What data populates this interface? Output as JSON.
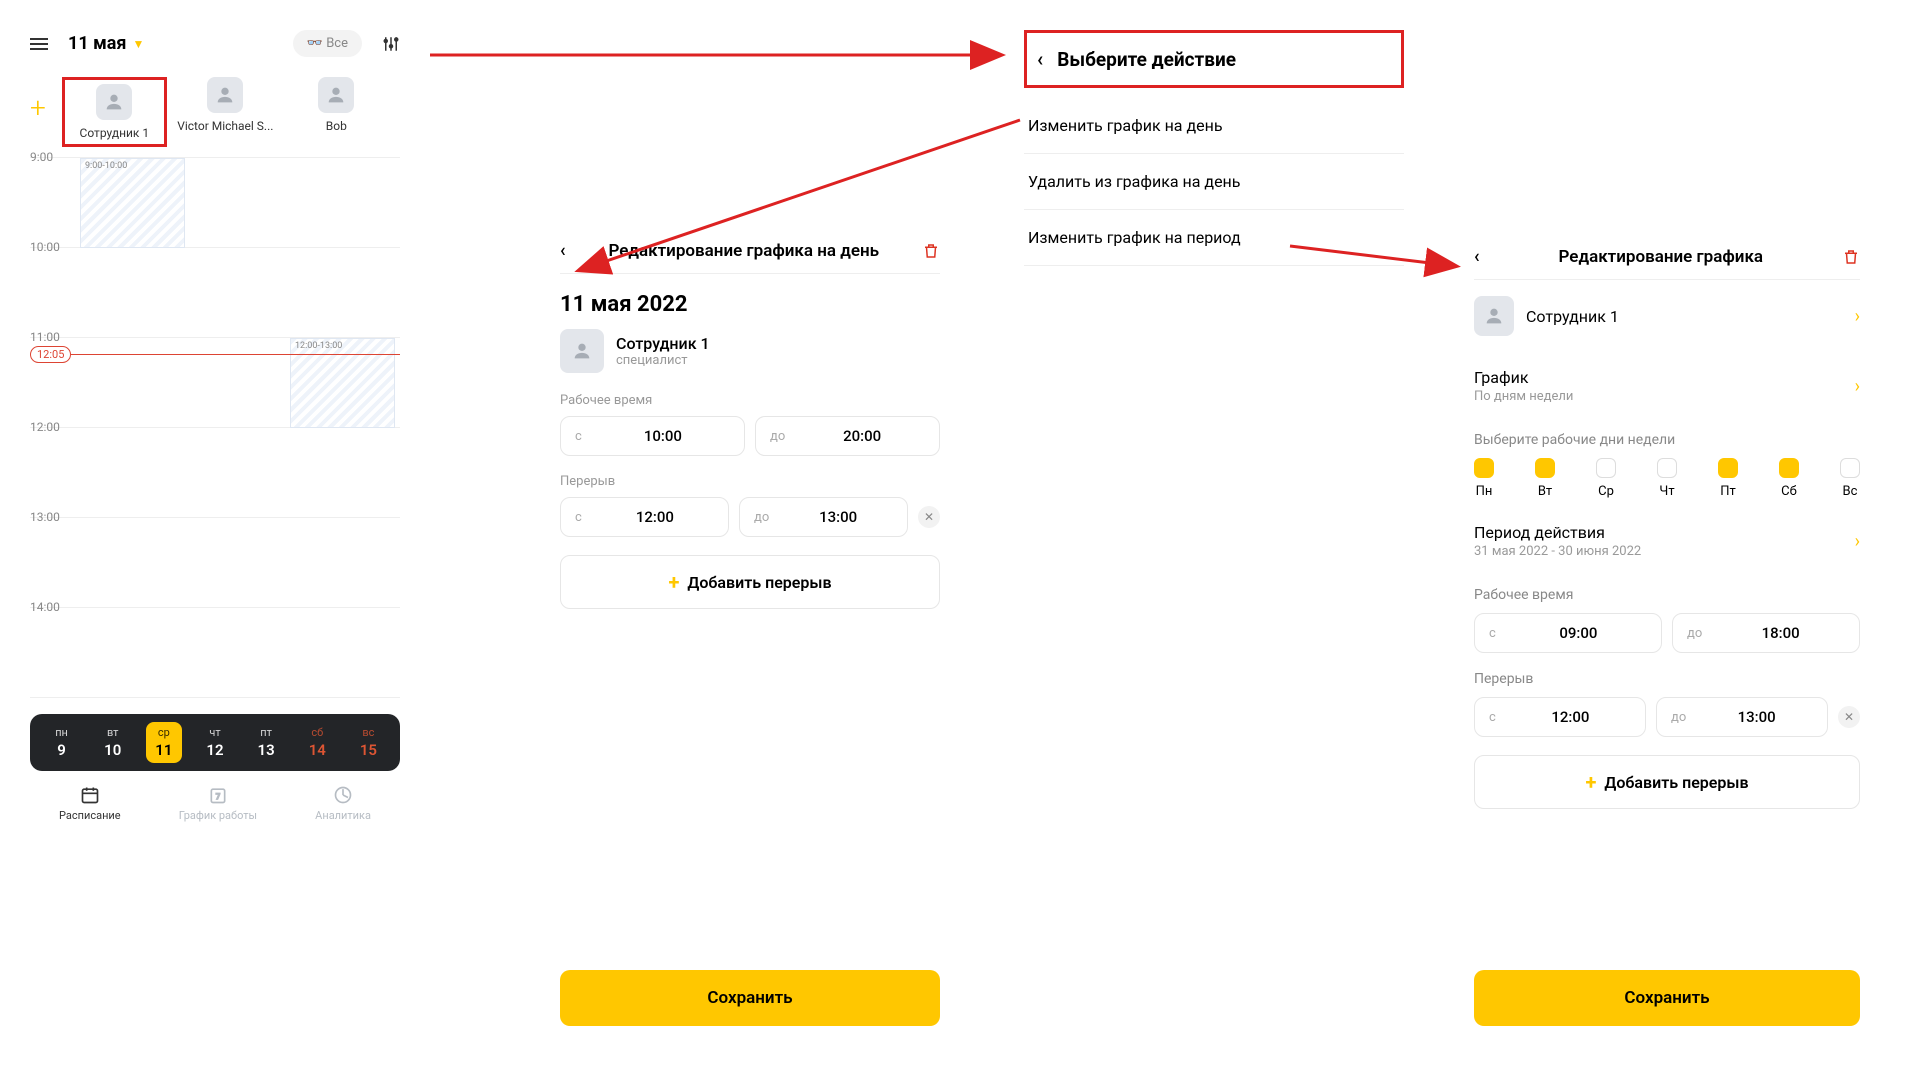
{
  "panel1": {
    "date": "11 мая",
    "all_button": "Все",
    "employees": [
      "Сотрудник 1",
      "Victor Michael S...",
      "Bob"
    ],
    "hours": [
      "9:00",
      "10:00",
      "11:00",
      "12:00",
      "13:00",
      "14:00"
    ],
    "event1": "9:00-10:00",
    "event2": "12:00-13:00",
    "now": "12:05",
    "week": [
      {
        "day": "пн",
        "date": "9"
      },
      {
        "day": "вт",
        "date": "10"
      },
      {
        "day": "ср",
        "date": "11",
        "sel": true
      },
      {
        "day": "чт",
        "date": "12"
      },
      {
        "day": "пт",
        "date": "13"
      },
      {
        "day": "сб",
        "date": "14",
        "wknd": true
      },
      {
        "day": "вс",
        "date": "15",
        "wknd": true
      }
    ],
    "tabs": [
      "Расписание",
      "График работы",
      "Аналитика"
    ]
  },
  "panel2": {
    "title": "Редактирование графика на день",
    "date": "11 мая 2022",
    "staff_name": "Сотрудник 1",
    "staff_role": "специалист",
    "work_label": "Рабочее время",
    "from": "с",
    "to": "до",
    "work_from": "10:00",
    "work_to": "20:00",
    "break_label": "Перерыв",
    "break_from": "12:00",
    "break_to": "13:00",
    "add_break": "Добавить перерыв",
    "save": "Сохранить"
  },
  "panel3": {
    "title": "Выберите действие",
    "items": [
      "Изменить график на день",
      "Удалить из графика на день",
      "Изменить график на период"
    ]
  },
  "panel4": {
    "title": "Редактирование графика",
    "staff": "Сотрудник 1",
    "sched": "График",
    "sched_sub": "По дням недели",
    "days_label": "Выберите рабочие дни недели",
    "days": [
      {
        "n": "Пн",
        "on": true
      },
      {
        "n": "Вт",
        "on": true
      },
      {
        "n": "Ср",
        "on": false
      },
      {
        "n": "Чт",
        "on": false
      },
      {
        "n": "Пт",
        "on": true
      },
      {
        "n": "Сб",
        "on": true
      },
      {
        "n": "Вс",
        "on": false
      }
    ],
    "period": "Период действия",
    "period_sub": "31 мая 2022 - 30 июня 2022",
    "work_label": "Рабочее время",
    "from": "с",
    "to": "до",
    "work_from": "09:00",
    "work_to": "18:00",
    "break_label": "Перерыв",
    "break_from": "12:00",
    "break_to": "13:00",
    "add_break": "Добавить перерыв",
    "save": "Сохранить"
  }
}
